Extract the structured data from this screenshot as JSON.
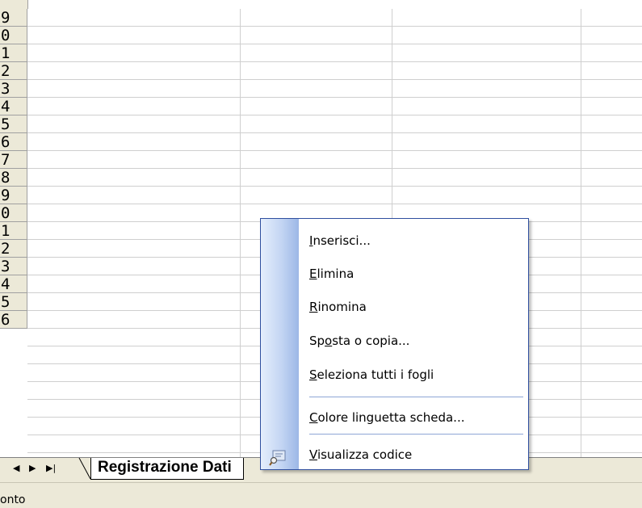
{
  "row_headers": [
    "9",
    "0",
    "1",
    "2",
    "3",
    "4",
    "5",
    "6",
    "7",
    "8",
    "9",
    "0",
    "1",
    "2",
    "3",
    "4",
    "5",
    "6"
  ],
  "sheet_nav": {
    "first_icon": "◀",
    "next_icon": "▶",
    "last_icon": "▶|"
  },
  "sheet_tab": {
    "label": "Registrazione Dati"
  },
  "status": {
    "text": "onto"
  },
  "context_menu": {
    "items": [
      {
        "pre": "",
        "acc": "I",
        "post": "nserisci..."
      },
      {
        "pre": "",
        "acc": "E",
        "post": "limina"
      },
      {
        "pre": "",
        "acc": "R",
        "post": "inomina"
      },
      {
        "pre": "Sp",
        "acc": "o",
        "post": "sta o copia..."
      },
      {
        "pre": "",
        "acc": "S",
        "post": "eleziona tutti i fogli"
      },
      {
        "pre": "",
        "acc": "C",
        "post": "olore linguetta scheda..."
      },
      {
        "pre": "",
        "acc": "V",
        "post": "isualizza codice"
      }
    ],
    "code_icon": "view-code-icon"
  }
}
